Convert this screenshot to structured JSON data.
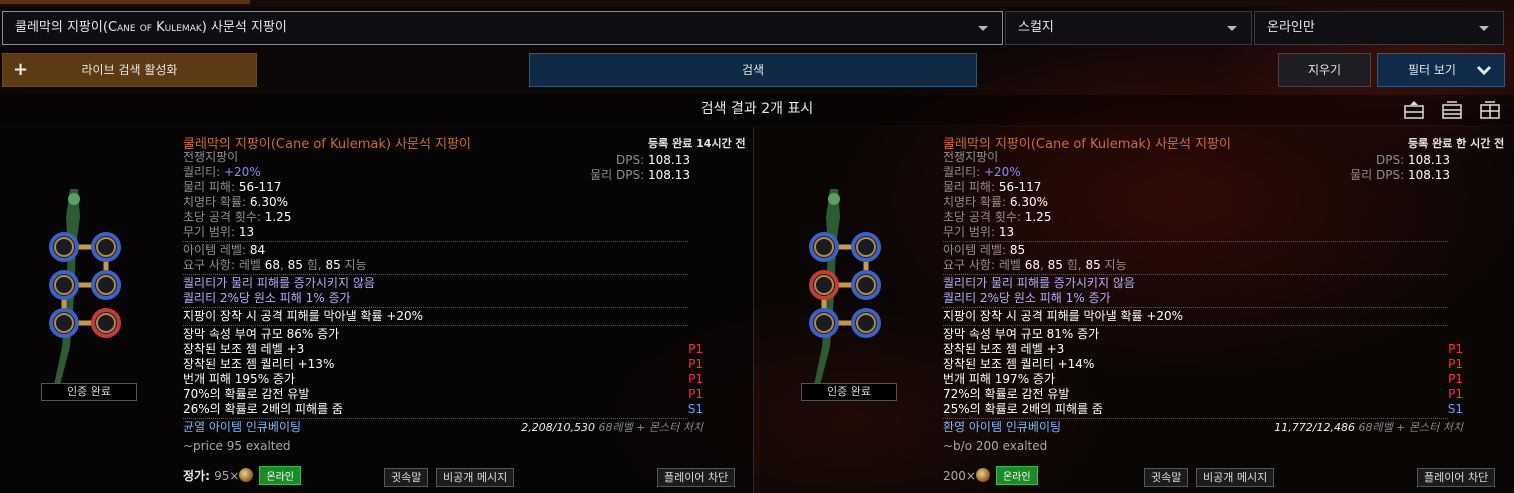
{
  "search": {
    "item_prefix": "쿨레막의 지팡이(",
    "item_en": "Cane of Kulemak",
    "item_suffix": ") 사문석 지팡이",
    "league": "스컬지",
    "status": "온라인만"
  },
  "buttons": {
    "live": "라이브 검색 활성화",
    "search": "검색",
    "clear": "지우기",
    "filters": "필터 보기"
  },
  "results_title": "검색 결과 2개 표시",
  "labels": {
    "type": "전쟁지팡이",
    "quality": "퀄리티:",
    "phys_damage": "물리 피해:",
    "crit": "치명타 확률:",
    "aps": "초당 공격 횟수:",
    "range": "무기 범위:",
    "ilvl": "아이템 레벨:",
    "req": "요구 사항:",
    "req_level": "레벨",
    "req_str": "힘,",
    "req_int": "지능",
    "dps": "DPS:",
    "pdps": "물리 DPS:",
    "verified": "인증 완료",
    "whisper": "귓속말",
    "pm": "비공개 메시지",
    "block": "플레이어 차단",
    "online": "온라인",
    "incub_suffix": "68레벨 + 몬스터 처치"
  },
  "results": [
    {
      "name": "쿨레막의 지팡이(Cane of Kulemak) 사문석 지팡이",
      "posted": "등록 완료 14시간 전",
      "quality": "+20%",
      "phys": "56-117",
      "crit": "6.30%",
      "aps": "1.25",
      "range": "13",
      "dps": "108.13",
      "pdps": "108.13",
      "ilvl": "84",
      "req_level": "68",
      "req_str": "85",
      "req_int": "85",
      "implicits": [
        "퀄리티가 물리 피해를 증가시키지 않음",
        "퀄리티 2%당 원소 피해 1% 증가"
      ],
      "enchant": "지팡이 장착 시 공격 피해를 막아낼 확률 +20%",
      "mods": [
        {
          "text": "장막 속성 부여 규모 86% 증가",
          "tag": ""
        },
        {
          "text": "장착된 보조 젬 레벨 +3",
          "tag": "P1"
        },
        {
          "text": "장착된 보조 젬 퀄리티 +13%",
          "tag": "P1"
        },
        {
          "text": "번개 피해 195% 증가",
          "tag": "P1"
        },
        {
          "text": "70%의 확률로 감전 유발",
          "tag": "P1"
        },
        {
          "text": "26%의 확률로 2배의 피해를 줌",
          "tag": "S1"
        }
      ],
      "incubator": "균열 아이템 인큐베이팅",
      "incub_progress": "2,208/10,530",
      "note": "~price 95 exalted",
      "price_label": "정가:",
      "price": "95×"
    },
    {
      "name": "쿨레막의 지팡이(Cane of Kulemak) 사문석 지팡이",
      "posted": "등록 완료 한 시간 전",
      "quality": "+20%",
      "phys": "56-117",
      "crit": "6.30%",
      "aps": "1.25",
      "range": "13",
      "dps": "108.13",
      "pdps": "108.13",
      "ilvl": "85",
      "req_level": "68",
      "req_str": "85",
      "req_int": "85",
      "implicits": [
        "퀄리티가 물리 피해를 증가시키지 않음",
        "퀄리티 2%당 원소 피해 1% 증가"
      ],
      "enchant": "지팡이 장착 시 공격 피해를 막아낼 확률 +20%",
      "mods": [
        {
          "text": "장막 속성 부여 규모 81% 증가",
          "tag": ""
        },
        {
          "text": "장착된 보조 젬 레벨 +3",
          "tag": "P1"
        },
        {
          "text": "장착된 보조 젬 퀄리티 +14%",
          "tag": "P1"
        },
        {
          "text": "번개 피해 197% 증가",
          "tag": "P1"
        },
        {
          "text": "72%의 확률로 감전 유발",
          "tag": "P1"
        },
        {
          "text": "25%의 확률로 2배의 피해를 줌",
          "tag": "S1"
        }
      ],
      "incubator": "환영 아이템 인큐베이팅",
      "incub_progress": "11,772/12,486",
      "note": "~b/o 200 exalted",
      "price_label": "",
      "price": "200×"
    }
  ],
  "colors": {
    "unique_name": "#d06a2c",
    "magic_mod": "#8888ff",
    "prefix_tag": "#ff3030",
    "suffix_tag": "#6aa0ff",
    "online": "#1c8a2a",
    "live_button": "#5c3a12",
    "search_button": "#0f2a44"
  }
}
